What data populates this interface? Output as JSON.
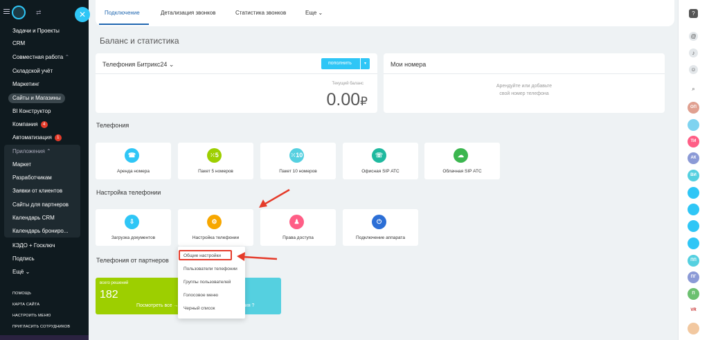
{
  "sidebar": {
    "items": [
      {
        "label": "Задачи и Проекты"
      },
      {
        "label": "CRM"
      },
      {
        "label": "Совместная работа"
      },
      {
        "label": "Складской учёт"
      },
      {
        "label": "Маркетинг"
      },
      {
        "label": "Сайты и Магазины"
      },
      {
        "label": "BI Конструктор"
      },
      {
        "label": "Компания",
        "badge": "4"
      },
      {
        "label": "Автоматизация",
        "badge": "1"
      },
      {
        "label": "Приложения"
      },
      {
        "label": "Маркет"
      },
      {
        "label": "Разработчикам"
      },
      {
        "label": "Заявки от клиентов"
      },
      {
        "label": "Сайты для партнеров"
      },
      {
        "label": "Календарь CRM"
      },
      {
        "label": "Календарь брониро..."
      },
      {
        "label": "КЭДО + Госключ"
      },
      {
        "label": "Подпись"
      },
      {
        "label": "Ещё"
      }
    ],
    "links": [
      "ПОМОЩЬ",
      "КАРТА САЙТА",
      "НАСТРОИТЬ МЕНЮ",
      "ПРИГЛАСИТЬ СОТРУДНИКОВ"
    ]
  },
  "tabs": [
    "Подключение",
    "Детализация звонков",
    "Статистика звонков",
    "Еще"
  ],
  "page_title": "Баланс и статистика",
  "balance": {
    "provider": "Телефония Битрикс24",
    "topup": "пополнить",
    "label": "Текущий баланс",
    "value": "0.00",
    "currency": "₽"
  },
  "numbers": {
    "title": "Мои номера",
    "text1": "Арендуйте или добавьте",
    "text2": "свой номер телефона"
  },
  "telephony": {
    "title": "Телефония",
    "tiles": [
      "Аренда номера",
      "Пакет 5 номеров",
      "Пакет 10 номеров",
      "Офисная SIP АТС",
      "Облачная SIP АТС"
    ]
  },
  "settings": {
    "title": "Настройка телефонии",
    "tiles": [
      "Загрузка документов",
      "Настройка телефонии",
      "Права доступа",
      "Подключение аппарата"
    ]
  },
  "partners": {
    "title": "Телефония от партнеров",
    "solutions_label": "всего решений",
    "solutions_count": "182",
    "view_all": "Посмотреть все",
    "consult": "ация ?"
  },
  "dropdown": [
    "Общие настройки",
    "Пользователи телефонии",
    "Группы пользователей",
    "Голосовое меню",
    "Черный список"
  ],
  "rightbar": [
    "ОП",
    "ТИ",
    "АК",
    "ВИ",
    "ПП",
    "ПГ",
    "П",
    "VR"
  ],
  "colors": {
    "accent": "#2fc6f6",
    "link": "#2067b0",
    "arrow": "#e53b2a",
    "green": "#9dcf00",
    "cyan": "#55d0e0"
  }
}
